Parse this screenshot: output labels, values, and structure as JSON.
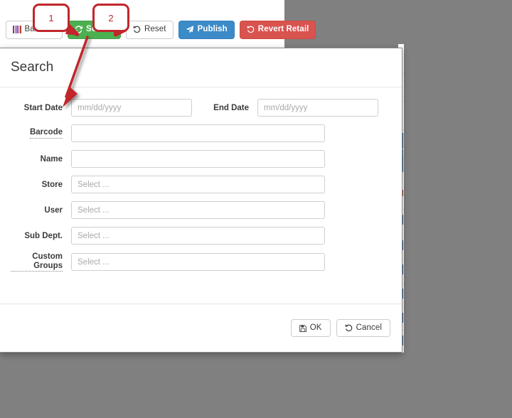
{
  "toolbar": {
    "buttons": [
      {
        "label": "Barcode",
        "icon": "barcode-icon",
        "style": "default"
      },
      {
        "label": "Search",
        "icon": "refresh-icon",
        "style": "success"
      },
      {
        "label": "Reset",
        "icon": "undo-icon",
        "style": "default"
      },
      {
        "label": "Publish",
        "icon": "send-icon",
        "style": "primary"
      },
      {
        "label": "Revert Retail",
        "icon": "undo-icon",
        "style": "danger"
      }
    ]
  },
  "callouts": [
    {
      "number": "1",
      "target": "Search"
    },
    {
      "number": "2",
      "target": "Reset"
    }
  ],
  "annotation": {
    "arrow": "red-arrow-search-to-start-date",
    "color": "#c0262b"
  },
  "dialog": {
    "title": "Search",
    "fields": {
      "start_date": {
        "label": "Start Date",
        "placeholder": "mm/dd/yyyy",
        "value": ""
      },
      "end_date": {
        "label": "End Date",
        "placeholder": "mm/dd/yyyy",
        "value": ""
      },
      "barcode": {
        "label": "Barcode",
        "placeholder": "",
        "value": "",
        "hinted": true
      },
      "name": {
        "label": "Name",
        "placeholder": "",
        "value": "",
        "hinted": false
      },
      "store": {
        "label": "Store",
        "placeholder": "Select ...",
        "value": "",
        "hinted": false
      },
      "user": {
        "label": "User",
        "placeholder": "Select ...",
        "value": "",
        "hinted": false
      },
      "sub_dept": {
        "label": "Sub Dept.",
        "placeholder": "Select ...",
        "value": "",
        "hinted": false
      },
      "custom_groups": {
        "label": "Custom Groups",
        "placeholder": "Select ...",
        "value": "",
        "hinted": true
      }
    },
    "footer": {
      "ok": {
        "label": "OK",
        "icon": "save-icon"
      },
      "cancel": {
        "label": "Cancel",
        "icon": "undo-icon"
      }
    }
  },
  "colors": {
    "success": "#4cb050",
    "primary": "#3b8bc9",
    "danger": "#d9534f",
    "annotation": "#c0262b",
    "backdrop": "#808080"
  }
}
